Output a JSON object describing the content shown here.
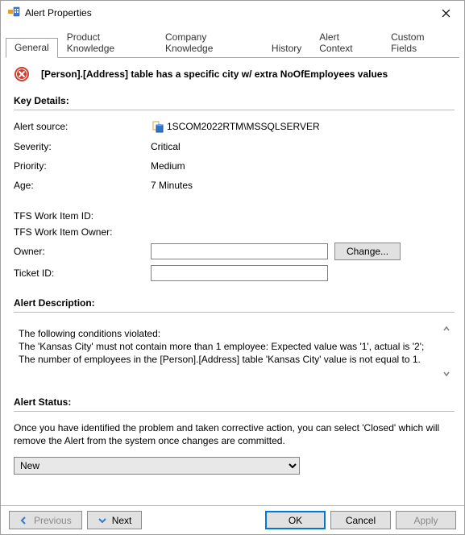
{
  "window": {
    "title": "Alert Properties"
  },
  "tabs": [
    {
      "label": "General"
    },
    {
      "label": "Product Knowledge"
    },
    {
      "label": "Company Knowledge"
    },
    {
      "label": "History"
    },
    {
      "label": "Alert Context"
    },
    {
      "label": "Custom Fields"
    }
  ],
  "alert": {
    "title": "[Person].[Address] table has a specific city w/ extra NoOfEmployees values"
  },
  "sections": {
    "key_details_heading": "Key Details:",
    "description_heading": "Alert Description:",
    "status_heading": "Alert Status:"
  },
  "key_details": {
    "labels": {
      "source": "Alert source:",
      "severity": "Severity:",
      "priority": "Priority:",
      "age": "Age:"
    },
    "values": {
      "source": "1SCOM2022RTM\\MSSQLSERVER",
      "severity": "Critical",
      "priority": "Medium",
      "age": "7 Minutes"
    }
  },
  "fields": {
    "tfs_work_item_id": {
      "label": "TFS Work Item ID:",
      "value": ""
    },
    "tfs_work_item_owner": {
      "label": "TFS Work Item Owner:",
      "value": ""
    },
    "owner": {
      "label": "Owner:",
      "value": "",
      "change_label": "Change..."
    },
    "ticket_id": {
      "label": "Ticket ID:",
      "value": ""
    }
  },
  "description": {
    "line1": "The following conditions violated:",
    "line2": "The 'Kansas City' must not contain more than 1 employee: Expected value was '1', actual is '2';",
    "line3": "The number of employees in the [Person].[Address] table 'Kansas City' value is not equal to 1."
  },
  "status": {
    "help_text": "Once you have identified the problem and taken corrective action, you can select 'Closed' which will remove the Alert from the system once changes are committed.",
    "selected": "New"
  },
  "buttons": {
    "previous": "Previous",
    "next": "Next",
    "ok": "OK",
    "cancel": "Cancel",
    "apply": "Apply"
  }
}
